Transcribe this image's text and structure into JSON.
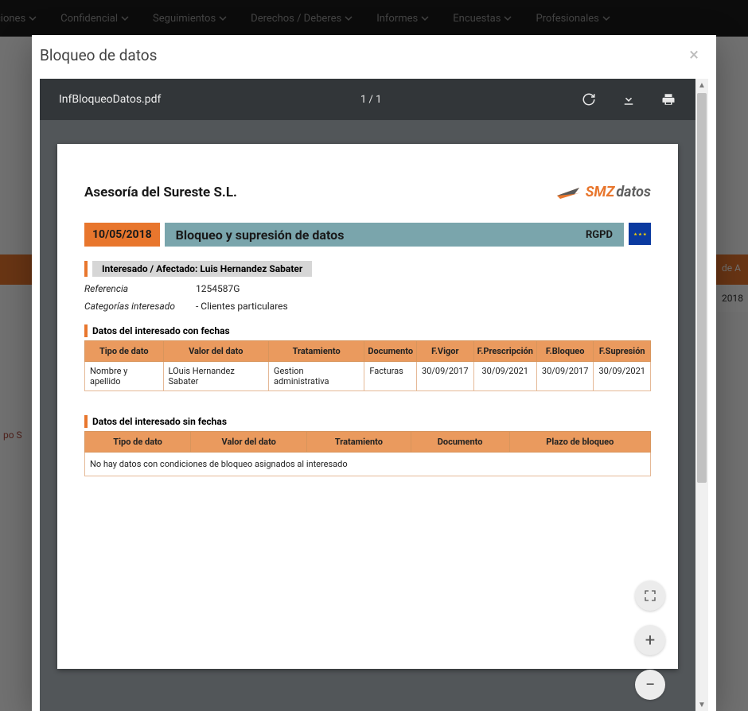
{
  "background": {
    "nav": [
      "ciones",
      "Confidencial",
      "Seguimientos",
      "Derechos / Deberes",
      "Informes",
      "Encuestas",
      "Profesionales"
    ],
    "orange_right_a": "de A",
    "orange_right_b": "2018",
    "side_text": "po S"
  },
  "modal": {
    "title": "Bloqueo de datos"
  },
  "pdf": {
    "filename": "InfBloqueoDatos.pdf",
    "page_indicator": "1  /  1"
  },
  "doc": {
    "company": "Asesoría del Sureste S.L.",
    "logo_a": "SMZ",
    "logo_b": "datos",
    "date": "10/05/2018",
    "title": "Bloqueo y supresión de datos",
    "rgpd": "RGPD",
    "affected_label": "Interesado / Afectado: Luis Hernandez Sabater",
    "meta": [
      {
        "k": "Referencia",
        "v": "1254587G"
      },
      {
        "k": "Categorías interesado",
        "v": "- Clientes particulares"
      }
    ],
    "table1": {
      "title": "Datos del interesado con fechas",
      "headers": [
        "Tipo de dato",
        "Valor del dato",
        "Tratamiento",
        "Documento",
        "F.Vigor",
        "F.Prescripción",
        "F.Bloqueo",
        "F.Supresión"
      ],
      "rows": [
        [
          "Nombre y apellido",
          "LOuis Hernandez Sabater",
          "Gestion administrativa",
          "Facturas",
          "30/09/2017",
          "30/09/2021",
          "30/09/2017",
          "30/09/2021"
        ]
      ]
    },
    "table2": {
      "title": "Datos del interesado sin fechas",
      "headers": [
        "Tipo de dato",
        "Valor del dato",
        "Tratamiento",
        "Documento",
        "Plazo de bloqueo"
      ],
      "empty_msg": "No hay datos con condiciones de bloqueo asignados al interesado"
    }
  }
}
